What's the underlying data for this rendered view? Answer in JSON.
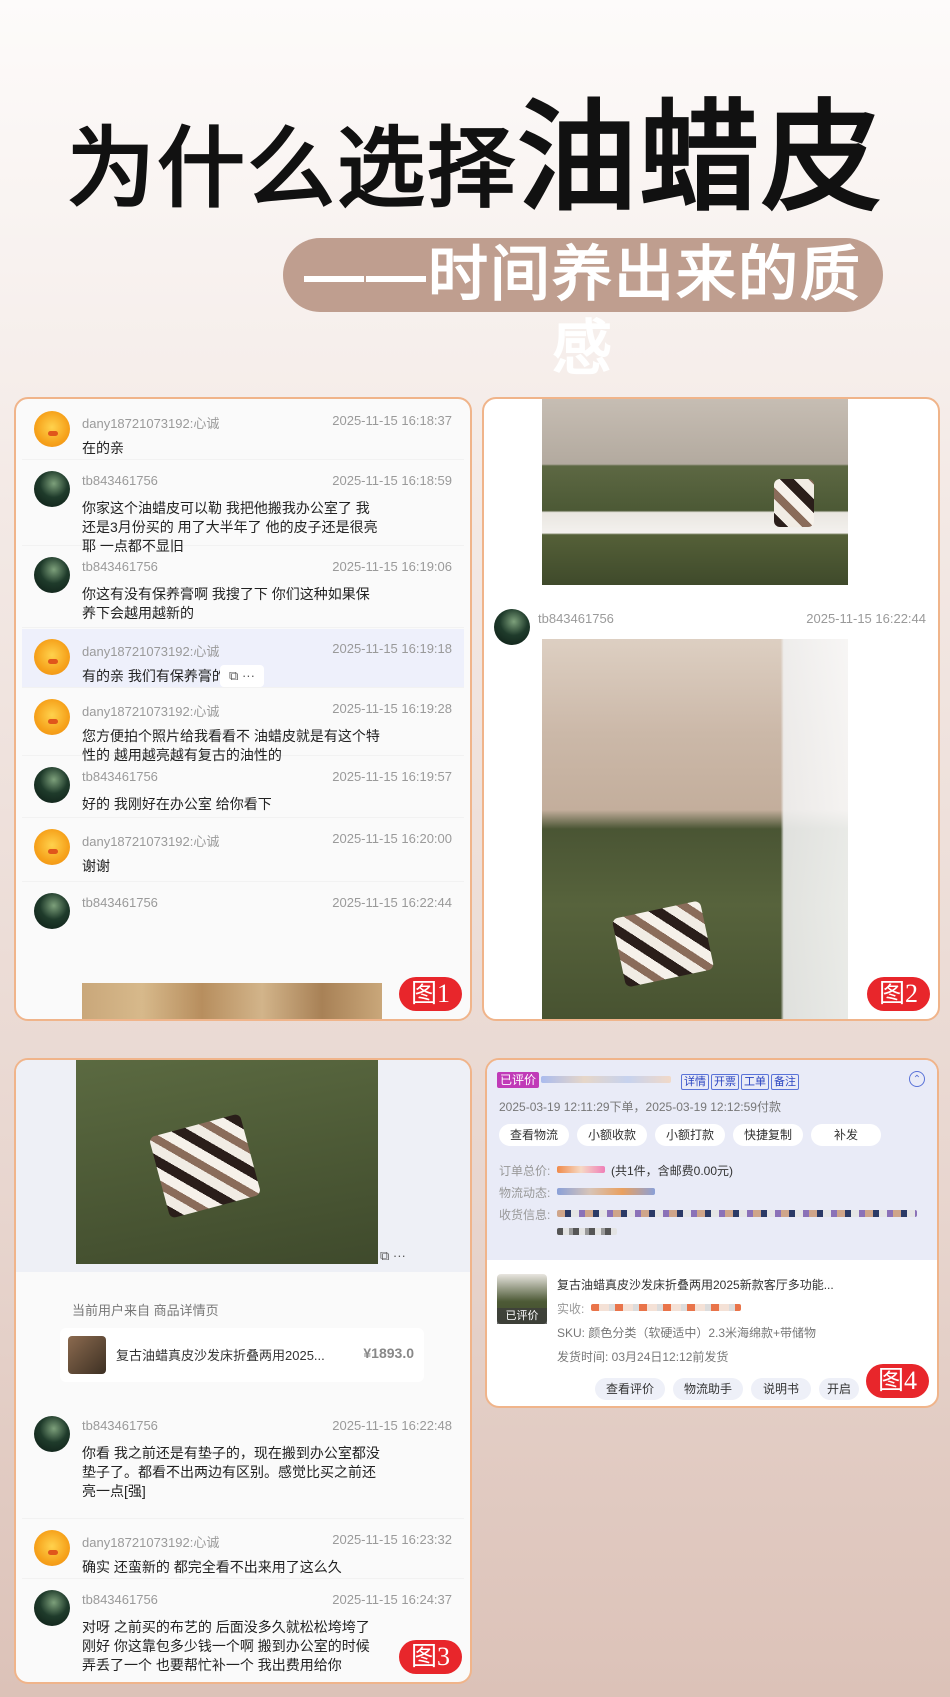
{
  "header": {
    "title_small": "为什么选择",
    "title_big": "油蜡皮",
    "subtitle": "——时间养出来的质感"
  },
  "badges": [
    "图1",
    "图2",
    "图3",
    "图4"
  ],
  "panel1": {
    "messages": [
      {
        "user": "dany18721073192:心诚",
        "time": "2025-11-15 16:18:37",
        "text": "在的亲",
        "avatar": "duck"
      },
      {
        "user": "tb843461756",
        "time": "2025-11-15 16:18:59",
        "text": "你家这个油蜡皮可以勒  我把他搬我办公室了 我还是3月份买的 用了大半年了 他的皮子还是很亮耶  一点都不显旧",
        "avatar": "night"
      },
      {
        "user": "tb843461756",
        "time": "2025-11-15 16:19:06",
        "text": "你这有没有保养膏啊  我搜了下  你们这种如果保养下会越用越新的",
        "avatar": "night"
      },
      {
        "user": "dany18721073192:心诚",
        "time": "2025-11-15 16:19:18",
        "text": "有的亲 我们有保养膏的",
        "avatar": "duck"
      },
      {
        "user": "dany18721073192:心诚",
        "time": "2025-11-15 16:19:28",
        "text": "您方便拍个照片给我看看不  油蜡皮就是有这个特性的  越用越亮越有复古的油性的",
        "avatar": "duck"
      },
      {
        "user": "tb843461756",
        "time": "2025-11-15 16:19:57",
        "text": "好的 我刚好在办公室 给你看下",
        "avatar": "night"
      },
      {
        "user": "dany18721073192:心诚",
        "time": "2025-11-15 16:20:00",
        "text": "谢谢",
        "avatar": "duck"
      },
      {
        "user": "tb843461756",
        "time": "2025-11-15 16:22:44",
        "text": "",
        "avatar": "night"
      }
    ],
    "hover_icons": "⧉ ···"
  },
  "panel2": {
    "user": "tb843461756",
    "time": "2025-11-15 16:22:44"
  },
  "panel3": {
    "image_icons": "⧉ ···",
    "source_label": "当前用户来自 商品详情页",
    "product_title": "复古油蜡真皮沙发床折叠两用2025...",
    "product_price": "¥1893.0",
    "messages": [
      {
        "user": "tb843461756",
        "time": "2025-11-15 16:22:48",
        "text": "你看 我之前还是有垫子的，现在搬到办公室都没垫子了。都看不出两边有区别。感觉比买之前还亮一点[强]",
        "avatar": "night"
      },
      {
        "user": "dany18721073192:心诚",
        "time": "2025-11-15 16:23:32",
        "text": "确实 还蛮新的  都完全看不出来用了这么久",
        "avatar": "duck"
      },
      {
        "user": "tb843461756",
        "time": "2025-11-15 16:24:37",
        "text": "对呀  之前买的布艺的 后面没多久就松松垮垮了 刚好 你这靠包多少钱一个啊 搬到办公室的时候弄丢了一个  也要帮忙补一个 我出费用给你",
        "avatar": "night"
      }
    ]
  },
  "panel4": {
    "status_tag": "已评价",
    "tags": [
      "详情",
      "开票",
      "工单",
      "备注"
    ],
    "collapse_icon": "⌃",
    "order_time": "2025-03-19 12:11:29下单，2025-03-19 12:12:59付款",
    "buttons": [
      "查看物流",
      "小额收款",
      "小额打款",
      "快捷复制",
      "补发"
    ],
    "order_total_label": "订单总价:",
    "order_total_note": "(共1件，含邮费0.00元)",
    "logistics_label": "物流动态:",
    "address_label": "收货信息:",
    "product_title": "复古油蜡真皮沙发床折叠两用2025新款客厅多功能...",
    "product_badge": "已评价",
    "paid_label": "实收:",
    "sku": "SKU:  颜色分类（软硬适中）2.3米海绵款+带储物",
    "ship_time": "发货时间:  03月24日12:12前发货",
    "bottom_buttons": [
      "查看评价",
      "物流助手",
      "说明书",
      "开启"
    ]
  },
  "colors": {
    "badge": "#e8262b",
    "panel_border": "#f0b48a",
    "pill": "#bf9e8f"
  }
}
